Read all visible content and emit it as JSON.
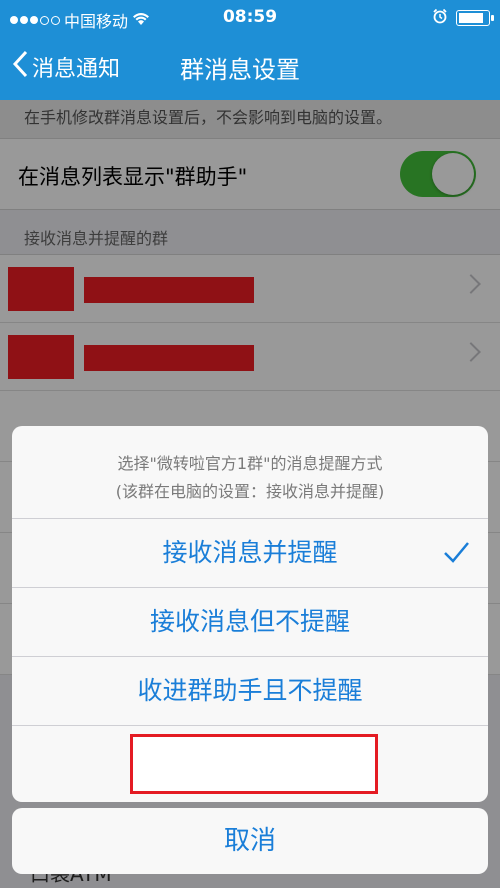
{
  "status_bar": {
    "carrier": "中国移动",
    "time": "08:59"
  },
  "nav": {
    "back_label": "消息通知",
    "title": "群消息设置"
  },
  "content": {
    "hint": "在手机修改群消息设置后，不会影响到电脑的设置。",
    "toggle_row": {
      "label": "在消息列表显示\"群助手\"",
      "toggle_on": true
    },
    "section_header": "接收消息并提醒的群",
    "bottom_partial_item": "口袋ATM"
  },
  "sheet": {
    "message_line1": "选择\"微转啦官方1群\"的消息提醒方式",
    "message_line2": "(该群在电脑的设置：接收消息并提醒)",
    "options": [
      {
        "label": "接收消息并提醒",
        "selected": true
      },
      {
        "label": "接收消息但不提醒",
        "selected": false
      },
      {
        "label": "收进群助手且不提醒",
        "selected": false
      }
    ],
    "cancel_label": "取消"
  },
  "colors": {
    "nav_bg": "#1e8fd6",
    "toggle_on": "#44c13b",
    "action_text": "#1a7ed8",
    "redaction": "#ee1d23"
  }
}
